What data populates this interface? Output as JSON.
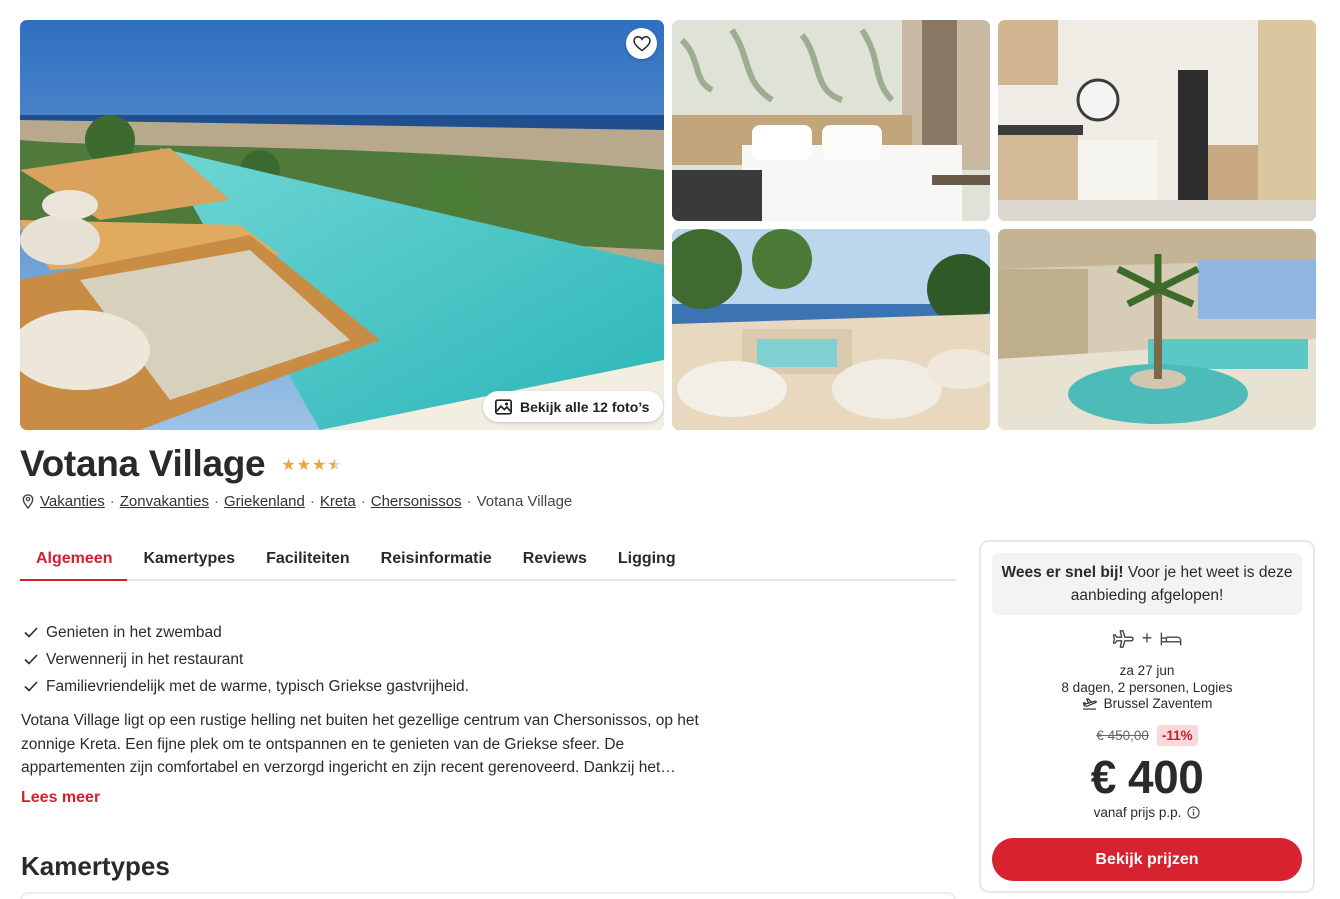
{
  "gallery": {
    "all_photos_label": "Bekijk alle 12 foto’s",
    "photos": [
      "pool-sea-view",
      "bedroom",
      "kitchen",
      "terrace-jacuzzi",
      "courtyard-pool"
    ]
  },
  "hotel": {
    "name": "Votana Village",
    "rating": 3.5
  },
  "breadcrumb": {
    "items": [
      "Vakanties",
      "Zonvakanties",
      "Griekenland",
      "Kreta",
      "Chersonissos"
    ],
    "current": "Votana Village"
  },
  "tabs": [
    "Algemeen",
    "Kamertypes",
    "Faciliteiten",
    "Reisinformatie",
    "Reviews",
    "Ligging"
  ],
  "usps": [
    "Genieten in het zwembad",
    "Verwennerij in het restaurant",
    "Familievriendelijk met de warme, typisch Griekse gastvrijheid."
  ],
  "description": "Votana Village ligt op een rustige helling net buiten het gezellige centrum van Chersonissos, op het zonnige Kreta. Een fijne plek om te ontspannen en te genieten van de Griekse sfeer. De appartementen zijn comfortabel en verzorgd ingericht en zijn recent gerenoveerd. Dankzij het…",
  "read_more_label": "Lees meer",
  "section_title": "Kamertypes",
  "booking": {
    "urgency_bold": "Wees er snel bij!",
    "urgency_text": " Voor je het weet is deze aanbieding afgelopen!",
    "plus": "+",
    "date": "za 27 jun",
    "details": "8 dagen, 2 personen, Logies",
    "airport": "Brussel Zaventem",
    "old_price": "€ 450,00",
    "discount": "-11%",
    "price": "€ 400",
    "price_note": "vanaf prijs p.p.",
    "cta_label": "Bekijk prijzen"
  },
  "colors": {
    "accent": "#d31f2e",
    "star": "#f0a33b",
    "discount_bg": "#fbd8da"
  }
}
